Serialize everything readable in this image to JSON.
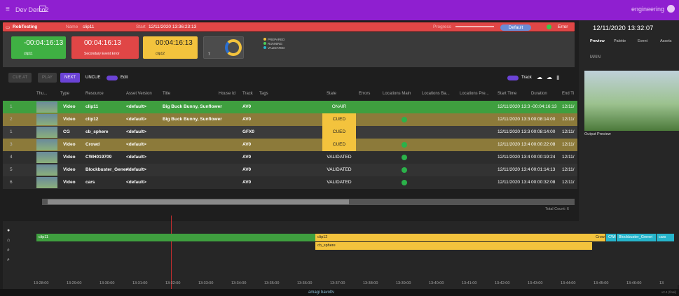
{
  "topbar": {
    "menu_icon": "hamburger-icon",
    "title": "Dev Demo2",
    "user": "engineering"
  },
  "redbar": {
    "project": "RobTesting",
    "name_label": "Name",
    "name_value": "clip11",
    "start_label": "Start",
    "start_value": "12/11/2020 13:36:23:13",
    "progress_label": "Progress",
    "profile": "Default",
    "status": "Error"
  },
  "cards": {
    "on_air": {
      "time": "-00:04:16:13",
      "label": "Asset",
      "asset": "clip11"
    },
    "error": {
      "time": "00:04:16:13",
      "label": "Error",
      "detail": "Secondary Event Error"
    },
    "next": {
      "time": "00:04:16:13",
      "label": "Asset",
      "asset": "clip12"
    },
    "total": {
      "label": "Total",
      "value": "7"
    }
  },
  "legend": [
    "PREPARED",
    "RUNNING",
    "VALIDATED"
  ],
  "toolbar": {
    "cue_at": "CUE AT",
    "play": "PLAY",
    "next": "NEXT",
    "uncue": "UNCUE",
    "edit": "Edit",
    "track": "Track"
  },
  "columns": [
    "Thu...",
    "Type",
    "Resource",
    "Asset Version",
    "Title",
    "House Id",
    "Track",
    "Tags",
    "State",
    "Errors",
    "Locations Main",
    "Locations Ba...",
    "Locations Pre...",
    "Start Time",
    "Duration",
    "End Ti"
  ],
  "rows": [
    {
      "idx": "1",
      "type": "Video",
      "resource": "clip11",
      "version": "<default>",
      "title": "Big Buck Bunny, Sunflower",
      "track": "AV0",
      "state": "ONAIR",
      "start": "12/11/2020 13:3",
      "duration": "-00:04:16:13",
      "end": "12/11/",
      "color": "#3f9f3f",
      "state_color": "#3f9f3f",
      "dot": false
    },
    {
      "idx": "2",
      "type": "Video",
      "resource": "clip12",
      "version": "<default>",
      "title": "Big Buck Bunny, Sunflower",
      "track": "AV0",
      "state": "CUED",
      "start": "12/11/2020 13:3",
      "duration": "00:08:14:00",
      "end": "12/11/",
      "color": "#8c7a3a",
      "state_color": "#f3c33d",
      "dot": true
    },
    {
      "idx": "1",
      "type": "CG",
      "resource": "cb_sphere",
      "version": "<default>",
      "title": "",
      "track": "GFX0",
      "state": "CUED",
      "start": "12/11/2020 13:3",
      "duration": "00:08:14:00",
      "end": "12/11/",
      "color": "#3b3b3b",
      "state_color": "#f3c33d",
      "dot": false
    },
    {
      "idx": "3",
      "type": "Video",
      "resource": "Crowd",
      "version": "<default>",
      "title": "",
      "track": "AV0",
      "state": "CUED",
      "start": "12/11/2020 13:4",
      "duration": "00:00:22:08",
      "end": "12/11/",
      "color": "#8c7a3a",
      "state_color": "#f3c33d",
      "dot": true
    },
    {
      "idx": "4",
      "type": "Video",
      "resource": "CWH019709",
      "version": "<default>",
      "title": "",
      "track": "AV0",
      "state": "VALIDATED",
      "start": "12/11/2020 13:4",
      "duration": "00:00:19:24",
      "end": "12/11/",
      "color": "#2d2d2d",
      "state_color": "transparent",
      "dot": true
    },
    {
      "idx": "5",
      "type": "Video",
      "resource": "Blockbuster_Generi",
      "version": "<default>",
      "title": "",
      "track": "AV0",
      "state": "VALIDATED",
      "start": "12/11/2020 13:4",
      "duration": "00:01:14:13",
      "end": "12/11/",
      "color": "#333",
      "state_color": "transparent",
      "dot": true
    },
    {
      "idx": "6",
      "type": "Video",
      "resource": "cars",
      "version": "<default>",
      "title": "",
      "track": "AV0",
      "state": "VALIDATED",
      "start": "12/11/2020 13:4",
      "duration": "00:00:32:08",
      "end": "12/11/",
      "color": "#2d2d2d",
      "state_color": "transparent",
      "dot": true
    }
  ],
  "total_count": "Total Count: 6",
  "right": {
    "date": "12/11/2020 13:32:07",
    "tabs": [
      "Preview",
      "Palette",
      "Event",
      "Assets"
    ],
    "channel": "MAIN",
    "output": "Output Preview"
  },
  "timeline": {
    "tracks": [
      {
        "label": "clip11",
        "color": "#3f9f3f"
      },
      {
        "label": "clip12",
        "color": "#f3c33d"
      },
      {
        "label": "cb_sphere",
        "color": "#f3c33d"
      },
      {
        "label": "Crow",
        "color": "#f3c33d"
      },
      {
        "label": "CWI",
        "color": "#26b5cc"
      },
      {
        "label": "Blockbuster_Generi",
        "color": "#26b5cc"
      },
      {
        "label": "cars",
        "color": "#26b5cc"
      }
    ],
    "ticks": [
      "13:28:00",
      "13:29:00",
      "13:30:00",
      "13:31:00",
      "13:32:00",
      "13:33:00",
      "13:34:00",
      "13:35:00",
      "13:36:00",
      "13:37:00",
      "13:38:00",
      "13:39:00",
      "13:40:00",
      "13:41:00",
      "13:42:00",
      "13:43:00",
      "13:44:00",
      "13:45:00",
      "13:46:00",
      "13"
    ]
  },
  "footer": {
    "brand": "amagi bavoltv",
    "version": "v2.4 (final)"
  }
}
